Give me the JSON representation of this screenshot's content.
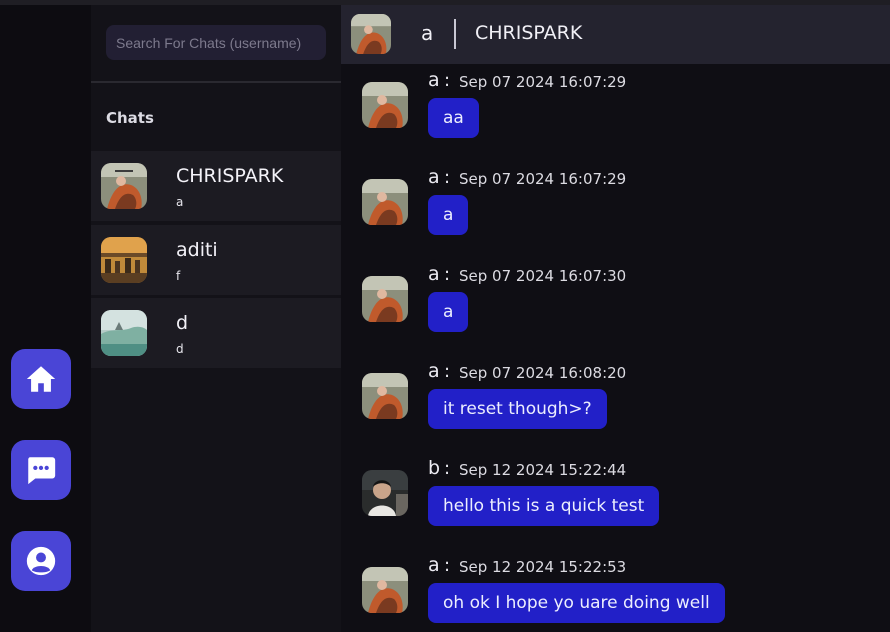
{
  "search": {
    "placeholder": "Search For Chats (username)"
  },
  "sidebar": {
    "title": "Chats",
    "chats": [
      {
        "name": "CHRISPARK",
        "last_message": "a",
        "avatar": "landscape-photo-orange"
      },
      {
        "name": "aditi",
        "last_message": "f",
        "avatar": "desert-ruins-photo"
      },
      {
        "name": "d",
        "last_message": "d",
        "avatar": "pale-landscape-photo"
      }
    ]
  },
  "rail": {
    "items": [
      {
        "icon": "home-icon"
      },
      {
        "icon": "chat-bubble-icon"
      },
      {
        "icon": "user-profile-icon"
      }
    ]
  },
  "header": {
    "me": "a",
    "partner": "CHRISPARK"
  },
  "messages": [
    {
      "sender": "a",
      "colon": ":",
      "timestamp": "Sep 07 2024 16:07:29",
      "text": "aa"
    },
    {
      "sender": "a",
      "colon": ":",
      "timestamp": "Sep 07 2024 16:07:29",
      "text": "a"
    },
    {
      "sender": "a",
      "colon": ":",
      "timestamp": "Sep 07 2024 16:07:30",
      "text": "a"
    },
    {
      "sender": "a",
      "colon": ":",
      "timestamp": "Sep 07 2024 16:08:20",
      "text": "it reset though>?"
    },
    {
      "sender": "b",
      "colon": ":",
      "timestamp": "Sep 12 2024 15:22:44",
      "text": "hello this is a quick test"
    },
    {
      "sender": "a",
      "colon": ":",
      "timestamp": "Sep 12 2024 15:22:53",
      "text": "oh ok I hope yo uare doing well"
    }
  ],
  "colors": {
    "accent": "#4a45d6",
    "bubble": "#2220c8",
    "background": "#0f0e14",
    "panel": "#1c1b22"
  }
}
